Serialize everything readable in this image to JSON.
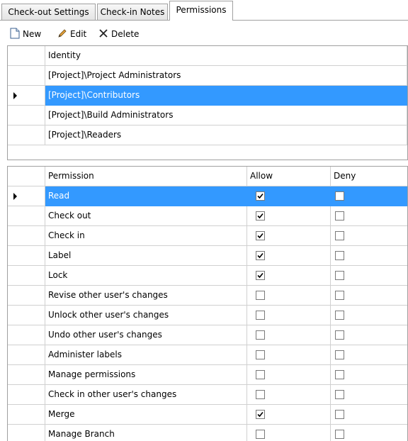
{
  "tabs": [
    {
      "label": "Check-out Settings",
      "active": false
    },
    {
      "label": "Check-in Notes",
      "active": false
    },
    {
      "label": "Permissions",
      "active": true
    }
  ],
  "toolbar": {
    "new_label": "New",
    "edit_label": "Edit",
    "delete_label": "Delete",
    "new_icon": "new-document-icon",
    "edit_icon": "pencil-icon",
    "delete_icon": "x-delete-icon"
  },
  "identity_grid": {
    "header": "Identity",
    "rows": [
      {
        "label": "[Project]\\Project Administrators",
        "selected": false
      },
      {
        "label": "[Project]\\Contributors",
        "selected": true
      },
      {
        "label": "[Project]\\Build Administrators",
        "selected": false
      },
      {
        "label": "[Project]\\Readers",
        "selected": false
      }
    ]
  },
  "permission_grid": {
    "headers": {
      "permission": "Permission",
      "allow": "Allow",
      "deny": "Deny"
    },
    "rows": [
      {
        "label": "Read",
        "allow": true,
        "deny": false,
        "selected": true
      },
      {
        "label": "Check out",
        "allow": true,
        "deny": false,
        "selected": false
      },
      {
        "label": "Check in",
        "allow": true,
        "deny": false,
        "selected": false
      },
      {
        "label": "Label",
        "allow": true,
        "deny": false,
        "selected": false
      },
      {
        "label": "Lock",
        "allow": true,
        "deny": false,
        "selected": false
      },
      {
        "label": "Revise other user's changes",
        "allow": false,
        "deny": false,
        "selected": false
      },
      {
        "label": "Unlock other user's changes",
        "allow": false,
        "deny": false,
        "selected": false
      },
      {
        "label": "Undo other user's changes",
        "allow": false,
        "deny": false,
        "selected": false
      },
      {
        "label": "Administer labels",
        "allow": false,
        "deny": false,
        "selected": false
      },
      {
        "label": "Manage permissions",
        "allow": false,
        "deny": false,
        "selected": false
      },
      {
        "label": "Check in other user's changes",
        "allow": false,
        "deny": false,
        "selected": false
      },
      {
        "label": "Merge",
        "allow": true,
        "deny": false,
        "selected": false
      },
      {
        "label": "Manage Branch",
        "allow": false,
        "deny": false,
        "selected": false
      }
    ]
  },
  "colors": {
    "selection": "#3399ff",
    "border": "#a0a0a0"
  }
}
